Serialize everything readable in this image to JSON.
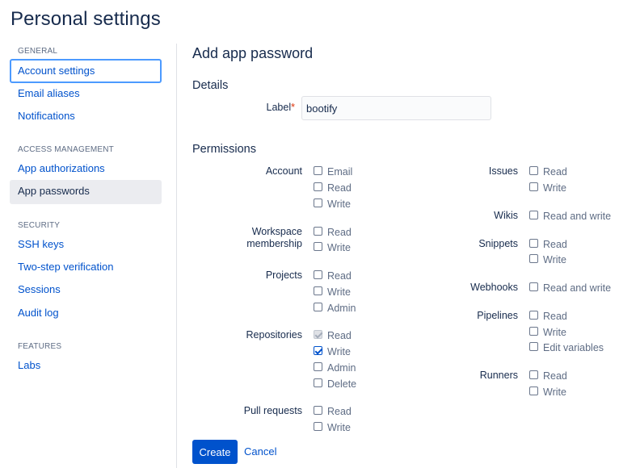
{
  "page_title": "Personal settings",
  "sidebar": {
    "sections": [
      {
        "heading": "GENERAL",
        "items": [
          "Account settings",
          "Email aliases",
          "Notifications"
        ]
      },
      {
        "heading": "ACCESS MANAGEMENT",
        "items": [
          "App authorizations",
          "App passwords"
        ]
      },
      {
        "heading": "SECURITY",
        "items": [
          "SSH keys",
          "Two-step verification",
          "Sessions",
          "Audit log"
        ]
      },
      {
        "heading": "FEATURES",
        "items": [
          "Labs"
        ]
      }
    ]
  },
  "main": {
    "title": "Add app password",
    "details_title": "Details",
    "label_field": {
      "label": "Label",
      "required": "*",
      "value": "bootify"
    },
    "permissions_title": "Permissions",
    "permissions": {
      "account": {
        "label": "Account",
        "options": [
          "Email",
          "Read",
          "Write"
        ]
      },
      "workspace": {
        "label_line1": "Workspace",
        "label_line2": "membership",
        "options": [
          "Read",
          "Write"
        ]
      },
      "projects": {
        "label": "Projects",
        "options": [
          "Read",
          "Write",
          "Admin"
        ]
      },
      "repositories": {
        "label": "Repositories",
        "options": [
          "Read",
          "Write",
          "Admin",
          "Delete"
        ]
      },
      "pull_requests": {
        "label": "Pull requests",
        "options": [
          "Read",
          "Write"
        ]
      },
      "issues": {
        "label": "Issues",
        "options": [
          "Read",
          "Write"
        ]
      },
      "wikis": {
        "label": "Wikis",
        "options": [
          "Read and write"
        ]
      },
      "snippets": {
        "label": "Snippets",
        "options": [
          "Read",
          "Write"
        ]
      },
      "webhooks": {
        "label": "Webhooks",
        "options": [
          "Read and write"
        ]
      },
      "pipelines": {
        "label": "Pipelines",
        "options": [
          "Read",
          "Write",
          "Edit variables"
        ]
      },
      "runners": {
        "label": "Runners",
        "options": [
          "Read",
          "Write"
        ]
      }
    },
    "buttons": {
      "create": "Create",
      "cancel": "Cancel"
    }
  },
  "colors": {
    "link": "#0052cc",
    "text": "#172b4d",
    "primary_button": "#0052cc",
    "focus_ring": "#4c9aff"
  }
}
